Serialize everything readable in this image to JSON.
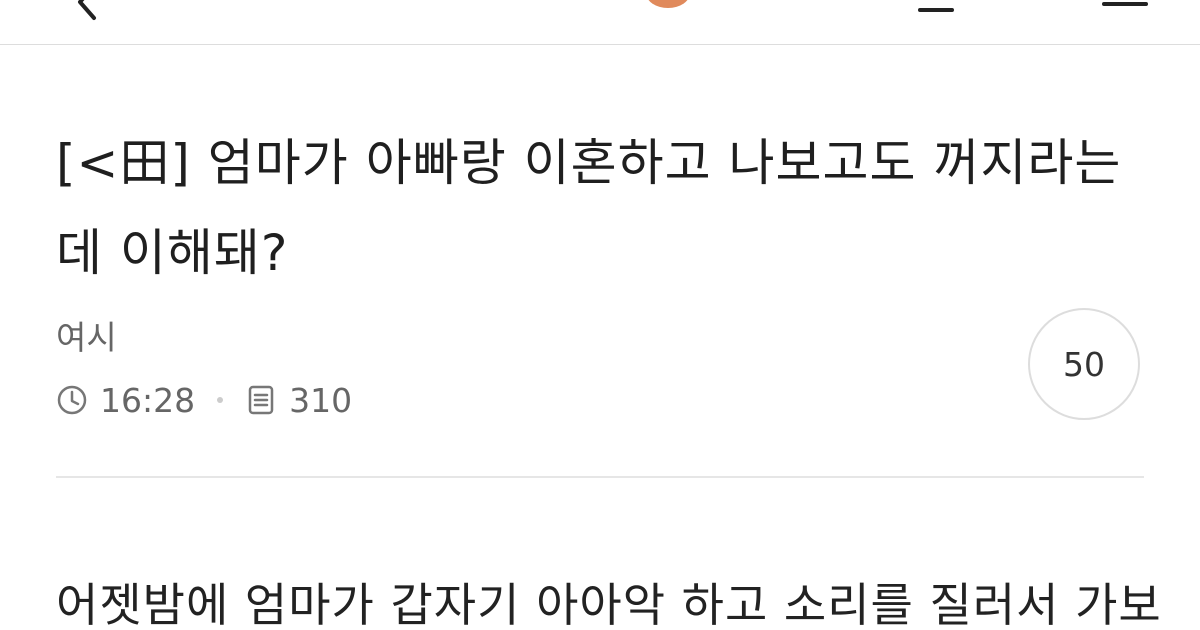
{
  "post": {
    "title": "[<田] 엄마가 아빠랑 이혼하고 나보고도 꺼지라는데 이해돼?",
    "author": "여시",
    "time": "16:28",
    "views": "310",
    "comment_count": "50",
    "body_first_line": "어젯밤에 엄마가 갑자기 아아악 하고 소리를 질러서 가보"
  },
  "colors": {
    "accent": "#e08a5c",
    "meta_text": "#666666",
    "divider": "#e6e6e6"
  },
  "icons": {
    "time": "clock-icon",
    "views": "document-icon",
    "back": "back-arrow-icon",
    "notify": "bell-icon",
    "menu": "menu-icon"
  }
}
